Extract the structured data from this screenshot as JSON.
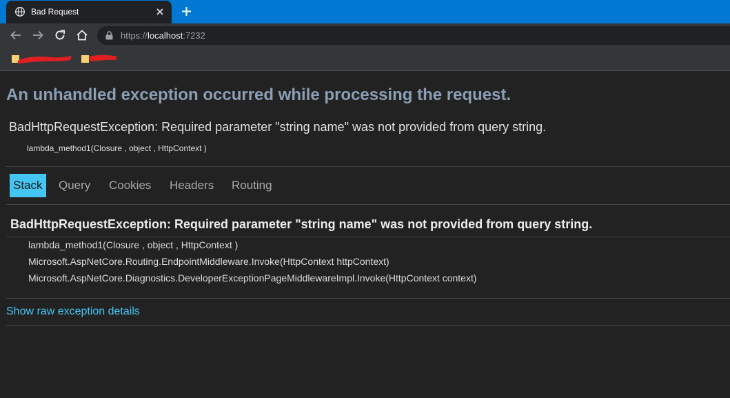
{
  "browser": {
    "tab_title": "Bad Request",
    "url_scheme": "https://",
    "url_host": "localhost",
    "url_port": ":7232",
    "accent_color": "#0078d4"
  },
  "page": {
    "title": "An unhandled exception occurred while processing the request.",
    "summary": {
      "message": "BadHttpRequestException: Required parameter \"string name\" was not provided from query string.",
      "location": "lambda_method1(Closure , object , HttpContext )"
    },
    "tabs": [
      {
        "label": "Stack",
        "active": true
      },
      {
        "label": "Query",
        "active": false
      },
      {
        "label": "Cookies",
        "active": false
      },
      {
        "label": "Headers",
        "active": false
      },
      {
        "label": "Routing",
        "active": false
      }
    ],
    "exception": {
      "header": "BadHttpRequestException: Required parameter \"string name\" was not provided from query string.",
      "frames": [
        "lambda_method1(Closure , object , HttpContext )",
        "Microsoft.AspNetCore.Routing.EndpointMiddleware.Invoke(HttpContext httpContext)",
        "Microsoft.AspNetCore.Diagnostics.DeveloperExceptionPageMiddlewareImpl.Invoke(HttpContext context)"
      ]
    },
    "raw_link": "Show raw exception details",
    "link_color": "#44c5f2",
    "title_color": "#8a9eb5"
  },
  "icons": [
    "globe-icon",
    "close-icon",
    "plus-icon",
    "back-arrow-icon",
    "forward-arrow-icon",
    "reload-icon",
    "home-icon",
    "lock-icon",
    "bookmark-folder-icon"
  ]
}
